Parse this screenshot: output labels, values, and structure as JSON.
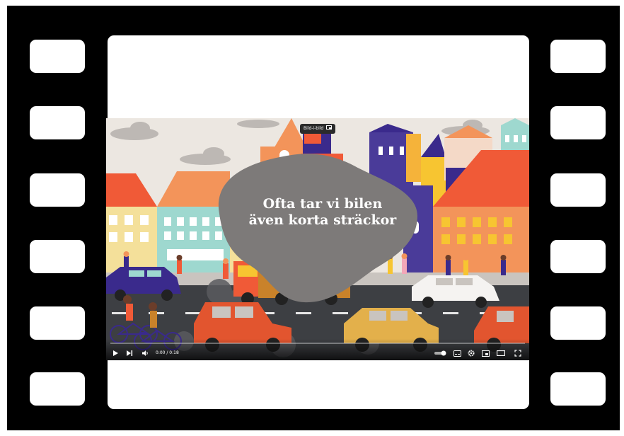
{
  "video": {
    "caption_line1": "Ofta tar vi bilen",
    "caption_line2": "även korta sträckor",
    "pip_label": "Bild-i-bild",
    "time_display": "0:00 / 0:18",
    "progress": 0.0
  },
  "controls": {
    "left_icons": [
      "play-icon",
      "next-icon",
      "volume-icon"
    ],
    "right_icons": [
      "autoplay-toggle-icon",
      "subtitles-icon",
      "settings-icon",
      "miniplayer-icon",
      "theater-mode-icon",
      "fullscreen-icon"
    ]
  },
  "colors": {
    "film_strip": "#000000",
    "cloud_blob": "#7d7a79",
    "road": "#3d3f43",
    "accent_orange": "#f05a37",
    "accent_purple": "#3a2a8c"
  }
}
